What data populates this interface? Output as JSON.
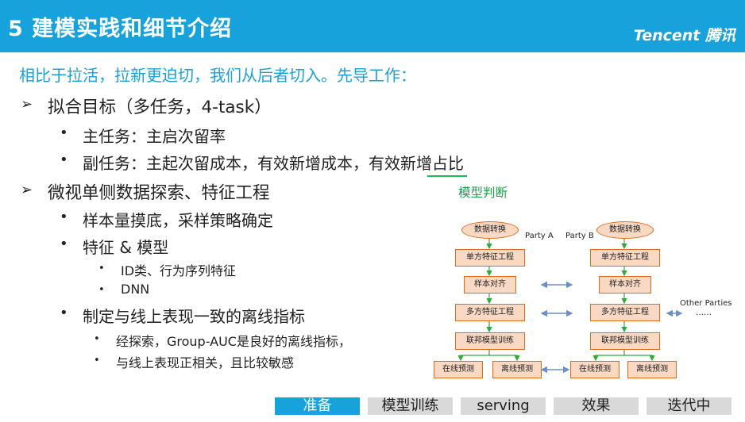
{
  "header": {
    "title": "5 建模实践和细节介绍",
    "logo": "Tencent 腾讯"
  },
  "subtitle": "相比于拉活，拉新更迫切，我们从后者切入。先导工作：",
  "outline": {
    "item1": "拟合目标（多任务，4-task）",
    "item1_sub1": "主任务：主启次留率",
    "item1_sub2": "副任务：主起次留成本，有效新增成本，有效新增占比",
    "item2": "微视单侧数据探索、特征工程",
    "item2_sub1": "样本量摸底，采样策略确定",
    "item2_sub2": "特征 & 模型",
    "item2_sub2_a": "ID类、行为序列特征",
    "item2_sub2_b": "DNN",
    "item2_sub3": "制定与线上表现一致的离线指标",
    "item2_sub3_a": "经探索，Group-AUC是良好的离线指标，",
    "item2_sub3_b": "与线上表现正相关，且比较敏感"
  },
  "diagram": {
    "title": "模型判断",
    "party_a": "Party A",
    "party_b": "Party B",
    "other": "Other Parties",
    "dots": "……",
    "a_nodes": [
      "数据转换",
      "单方特征工程",
      "样本对齐",
      "多方特征工程",
      "联邦模型训练"
    ],
    "b_nodes": [
      "数据转换",
      "单方特征工程",
      "样本对齐",
      "多方特征工程",
      "联邦模型训练"
    ],
    "a_leaves": [
      "在线预测",
      "离线预测"
    ],
    "b_leaves": [
      "在线预测",
      "离线预测"
    ],
    "colors": {
      "node_fill": "#f9d8c4",
      "node_border": "#e06a1a",
      "arrow_green": "#2eaa3e",
      "arrow_blue": "#6a8fc9"
    }
  },
  "nav": {
    "tabs": [
      "准备",
      "模型训练",
      "serving",
      "效果",
      "迭代中"
    ],
    "active": "准备"
  },
  "colors": {
    "accent": "#17a2dc"
  }
}
